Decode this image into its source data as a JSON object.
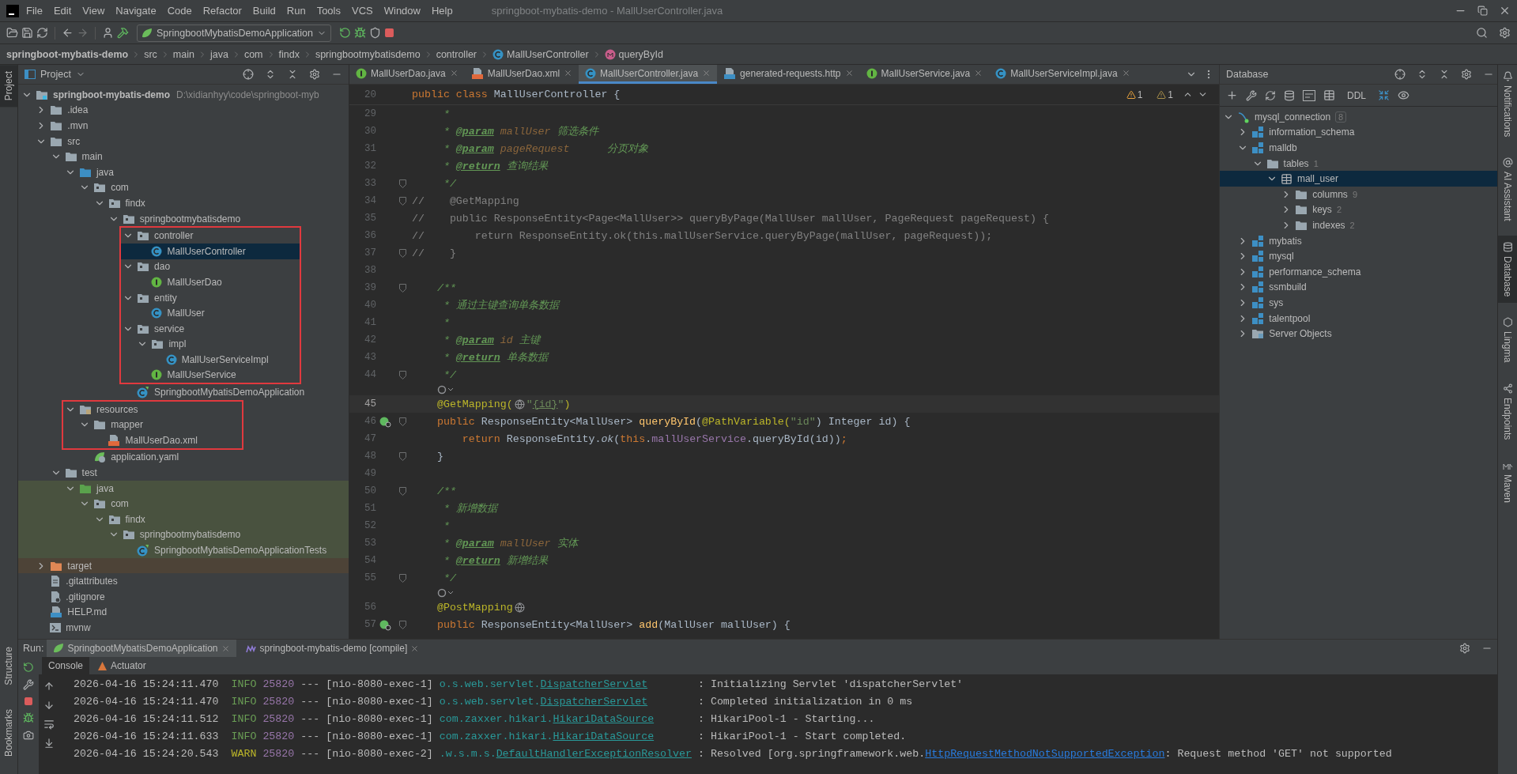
{
  "window": {
    "title": "springboot-mybatis-demo - MallUserController.java"
  },
  "menu": [
    "File",
    "Edit",
    "View",
    "Navigate",
    "Code",
    "Refactor",
    "Build",
    "Run",
    "Tools",
    "VCS",
    "Window",
    "Help"
  ],
  "run_configuration": {
    "label": "SpringbootMybatisDemoApplication"
  },
  "breadcrumbs": [
    {
      "label": "springboot-mybatis-demo",
      "kind": "project"
    },
    {
      "label": "src",
      "kind": "folder"
    },
    {
      "label": "main",
      "kind": "folder"
    },
    {
      "label": "java",
      "kind": "folder"
    },
    {
      "label": "com",
      "kind": "folder"
    },
    {
      "label": "findx",
      "kind": "folder"
    },
    {
      "label": "springbootmybatisdemo",
      "kind": "folder"
    },
    {
      "label": "controller",
      "kind": "folder"
    },
    {
      "label": "MallUserController",
      "kind": "class"
    },
    {
      "label": "queryById",
      "kind": "method"
    }
  ],
  "left_strip": {
    "top": [
      {
        "label": "Project",
        "selected": true
      }
    ],
    "bottom": [
      {
        "label": "Structure",
        "selected": false
      },
      {
        "label": "Bookmarks",
        "selected": false
      }
    ]
  },
  "project": {
    "title": "Project",
    "tree": [
      {
        "label": "springboot-mybatis-demo",
        "path": "D:\\xidianhyy\\code\\springboot-myb",
        "kind": "module",
        "expanded": true,
        "selected": false,
        "highlighted": false,
        "children": [
          {
            "label": ".idea",
            "kind": "folder",
            "expanded": false,
            "selected": false,
            "highlighted": false
          },
          {
            "label": ".mvn",
            "kind": "folder",
            "expanded": false,
            "selected": false,
            "highlighted": false
          },
          {
            "label": "src",
            "kind": "folder",
            "expanded": true,
            "selected": false,
            "highlighted": false,
            "children": [
              {
                "label": "main",
                "kind": "folder",
                "expanded": true,
                "selected": false,
                "highlighted": false,
                "children": [
                  {
                    "label": "java",
                    "kind": "source",
                    "expanded": true,
                    "selected": false,
                    "highlighted": false,
                    "children": [
                      {
                        "label": "com",
                        "kind": "package",
                        "expanded": true,
                        "selected": false,
                        "highlighted": false,
                        "children": [
                          {
                            "label": "findx",
                            "kind": "package",
                            "expanded": true,
                            "selected": false,
                            "highlighted": false,
                            "children": [
                              {
                                "label": "springbootmybatisdemo",
                                "kind": "package",
                                "expanded": true,
                                "selected": false,
                                "highlighted": false,
                                "children": [
                                  {
                                    "label": "controller",
                                    "kind": "package",
                                    "expanded": true,
                                    "selected": false,
                                    "highlighted": true,
                                    "children": [
                                      {
                                        "label": "MallUserController",
                                        "kind": "class",
                                        "selected": true,
                                        "highlighted": true
                                      }
                                    ]
                                  },
                                  {
                                    "label": "dao",
                                    "kind": "package",
                                    "expanded": true,
                                    "selected": false,
                                    "highlighted": true,
                                    "children": [
                                      {
                                        "label": "MallUserDao",
                                        "kind": "interface",
                                        "selected": false,
                                        "highlighted": true
                                      }
                                    ]
                                  },
                                  {
                                    "label": "entity",
                                    "kind": "package",
                                    "expanded": true,
                                    "selected": false,
                                    "highlighted": true,
                                    "children": [
                                      {
                                        "label": "MallUser",
                                        "kind": "class",
                                        "selected": false,
                                        "highlighted": true
                                      }
                                    ]
                                  },
                                  {
                                    "label": "service",
                                    "kind": "package",
                                    "expanded": true,
                                    "selected": false,
                                    "highlighted": true,
                                    "children": [
                                      {
                                        "label": "impl",
                                        "kind": "package",
                                        "expanded": true,
                                        "selected": false,
                                        "highlighted": true,
                                        "children": [
                                          {
                                            "label": "MallUserServiceImpl",
                                            "kind": "class",
                                            "selected": false,
                                            "highlighted": true
                                          }
                                        ]
                                      },
                                      {
                                        "label": "MallUserService",
                                        "kind": "interface",
                                        "selected": false,
                                        "highlighted": true
                                      }
                                    ]
                                  },
                                  {
                                    "label": "SpringbootMybatisDemoApplication",
                                    "kind": "app-class",
                                    "selected": false,
                                    "highlighted": false
                                  }
                                ]
                              }
                            ]
                          }
                        ]
                      }
                    ]
                  },
                  {
                    "label": "resources",
                    "kind": "resources",
                    "expanded": true,
                    "selected": false,
                    "highlighted": true,
                    "children": [
                      {
                        "label": "mapper",
                        "kind": "folder",
                        "expanded": true,
                        "selected": false,
                        "highlighted": true,
                        "children": [
                          {
                            "label": "MallUserDao.xml",
                            "kind": "xml",
                            "selected": false,
                            "highlighted": true
                          }
                        ]
                      },
                      {
                        "label": "application.yaml",
                        "kind": "yaml",
                        "selected": false,
                        "highlighted": false
                      }
                    ]
                  }
                ]
              },
              {
                "label": "test",
                "kind": "folder",
                "expanded": true,
                "selected": false,
                "highlighted": false,
                "children": [
                  {
                    "label": "java",
                    "kind": "test-source",
                    "expanded": true,
                    "selected": false,
                    "highlighted": false,
                    "children": [
                      {
                        "label": "com",
                        "kind": "package",
                        "expanded": true,
                        "selected": false,
                        "highlighted": false,
                        "children": [
                          {
                            "label": "findx",
                            "kind": "package",
                            "expanded": true,
                            "selected": false,
                            "highlighted": false,
                            "children": [
                              {
                                "label": "springbootmybatisdemo",
                                "kind": "package",
                                "expanded": true,
                                "selected": false,
                                "highlighted": false,
                                "children": [
                                  {
                                    "label": "SpringbootMybatisDemoApplicationTests",
                                    "kind": "app-class",
                                    "selected": false,
                                    "highlighted": false
                                  }
                                ]
                              }
                            ]
                          }
                        ]
                      }
                    ]
                  }
                ]
              }
            ]
          },
          {
            "label": "target",
            "kind": "excluded",
            "expanded": false,
            "selected": false,
            "highlighted": false
          },
          {
            "label": ".gitattributes",
            "kind": "text",
            "selected": false,
            "highlighted": false
          },
          {
            "label": ".gitignore",
            "kind": "git",
            "selected": false,
            "highlighted": false
          },
          {
            "label": "HELP.md",
            "kind": "md",
            "selected": false,
            "highlighted": false
          },
          {
            "label": "mvnw",
            "kind": "shell",
            "selected": false,
            "highlighted": false
          }
        ]
      }
    ]
  },
  "editor": {
    "tabs": [
      {
        "label": "MallUserDao.java",
        "kind": "interface",
        "selected": false
      },
      {
        "label": "MallUserDao.xml",
        "kind": "xml",
        "selected": false
      },
      {
        "label": "MallUserController.java",
        "kind": "class",
        "selected": true
      },
      {
        "label": "generated-requests.http",
        "kind": "http",
        "selected": false
      },
      {
        "label": "MallUserService.java",
        "kind": "interface",
        "selected": false
      },
      {
        "label": "MallUserServiceImpl.java",
        "kind": "class",
        "selected": false
      }
    ],
    "sticky_line": {
      "number": "20",
      "tokens": [
        {
          "kind": "keyword",
          "text": "public class"
        },
        {
          "kind": "plain",
          "text": " MallUserController {"
        }
      ]
    },
    "inspections": [
      {
        "kind": "warning",
        "count": "1"
      },
      {
        "kind": "weak",
        "count": "1"
      }
    ],
    "lines": [
      {
        "kind": "code",
        "number": "29",
        "tokens": [
          {
            "kind": "doc",
            "text": "     *"
          }
        ]
      },
      {
        "kind": "code",
        "number": "30",
        "tokens": [
          {
            "kind": "doc",
            "text": "     * "
          },
          {
            "kind": "doctag",
            "text": "@param"
          },
          {
            "kind": "docparam",
            "text": " mallUser"
          },
          {
            "kind": "doc",
            "text": " 筛选条件"
          }
        ]
      },
      {
        "kind": "code",
        "number": "31",
        "tokens": [
          {
            "kind": "doc",
            "text": "     * "
          },
          {
            "kind": "doctag",
            "text": "@param"
          },
          {
            "kind": "docparam",
            "text": " pageRequest"
          },
          {
            "kind": "doc",
            "text": "      分页对象"
          }
        ]
      },
      {
        "kind": "code",
        "number": "32",
        "tokens": [
          {
            "kind": "doc",
            "text": "     * "
          },
          {
            "kind": "doctag",
            "text": "@return"
          },
          {
            "kind": "doc",
            "text": " 查询结果"
          }
        ]
      },
      {
        "kind": "code",
        "number": "33",
        "fold": true,
        "tokens": [
          {
            "kind": "doc",
            "text": "     */"
          }
        ]
      },
      {
        "kind": "code",
        "number": "34",
        "fold": true,
        "tokens": [
          {
            "kind": "comment",
            "text": "//    @GetMapping"
          }
        ]
      },
      {
        "kind": "code",
        "number": "35",
        "tokens": [
          {
            "kind": "comment",
            "text": "//    public ResponseEntity<Page<MallUser>> queryByPage(MallUser mallUser, PageRequest pageRequest) {"
          }
        ]
      },
      {
        "kind": "code",
        "number": "36",
        "tokens": [
          {
            "kind": "comment",
            "text": "//        return ResponseEntity.ok(this.mallUserService.queryByPage(mallUser, pageRequest));"
          }
        ]
      },
      {
        "kind": "code",
        "number": "37",
        "fold": true,
        "tokens": [
          {
            "kind": "comment",
            "text": "//    }"
          }
        ]
      },
      {
        "kind": "code",
        "number": "38"
      },
      {
        "kind": "code",
        "number": "39",
        "fold": true,
        "tokens": [
          {
            "kind": "doc",
            "text": "    /**"
          }
        ]
      },
      {
        "kind": "code",
        "number": "40",
        "tokens": [
          {
            "kind": "doc",
            "text": "     * 通过主键查询单条数据"
          }
        ]
      },
      {
        "kind": "code",
        "number": "41",
        "tokens": [
          {
            "kind": "doc",
            "text": "     *"
          }
        ]
      },
      {
        "kind": "code",
        "number": "42",
        "tokens": [
          {
            "kind": "doc",
            "text": "     * "
          },
          {
            "kind": "doctag",
            "text": "@param"
          },
          {
            "kind": "docparam",
            "text": " id"
          },
          {
            "kind": "doc",
            "text": " 主键"
          }
        ]
      },
      {
        "kind": "code",
        "number": "43",
        "tokens": [
          {
            "kind": "doc",
            "text": "     * "
          },
          {
            "kind": "doctag",
            "text": "@return"
          },
          {
            "kind": "doc",
            "text": " 单条数据"
          }
        ]
      },
      {
        "kind": "code",
        "number": "44",
        "fold": true,
        "tokens": [
          {
            "kind": "doc",
            "text": "     */"
          }
        ]
      },
      {
        "kind": "inlay"
      },
      {
        "kind": "code",
        "number": "45",
        "current": true,
        "tokens": [
          {
            "kind": "annotation",
            "text": "    @GetMapping("
          },
          {
            "kind": "icon"
          },
          {
            "kind": "string",
            "text": "\""
          },
          {
            "kind": "string-ref",
            "text": "{id}"
          },
          {
            "kind": "string",
            "text": "\""
          },
          {
            "kind": "annotation",
            "text": ")"
          }
        ]
      },
      {
        "kind": "code",
        "number": "46",
        "run": true,
        "fold": true,
        "tokens": [
          {
            "kind": "keyword",
            "text": "    public"
          },
          {
            "kind": "plain",
            "text": " ResponseEntity<MallUser> "
          },
          {
            "kind": "method",
            "text": "queryById"
          },
          {
            "kind": "plain",
            "text": "("
          },
          {
            "kind": "annotation",
            "text": "@PathVariable("
          },
          {
            "kind": "string",
            "text": "\"id\""
          },
          {
            "kind": "plain",
            "text": ") Integer id) {"
          }
        ]
      },
      {
        "kind": "code",
        "number": "47",
        "tokens": [
          {
            "kind": "keyword",
            "text": "        return"
          },
          {
            "kind": "plain",
            "text": " ResponseEntity."
          },
          {
            "kind": "static",
            "text": "ok"
          },
          {
            "kind": "plain",
            "text": "("
          },
          {
            "kind": "keyword",
            "text": "this"
          },
          {
            "kind": "plain",
            "text": "."
          },
          {
            "kind": "field",
            "text": "mallUserService"
          },
          {
            "kind": "plain",
            "text": ".queryById(id))"
          },
          {
            "kind": "keyword",
            "text": ";"
          }
        ]
      },
      {
        "kind": "code",
        "number": "48",
        "fold": true,
        "tokens": [
          {
            "kind": "plain",
            "text": "    }"
          }
        ]
      },
      {
        "kind": "code",
        "number": "49"
      },
      {
        "kind": "code",
        "number": "50",
        "fold": true,
        "tokens": [
          {
            "kind": "doc",
            "text": "    /**"
          }
        ]
      },
      {
        "kind": "code",
        "number": "51",
        "tokens": [
          {
            "kind": "doc",
            "text": "     * 新增数据"
          }
        ]
      },
      {
        "kind": "code",
        "number": "52",
        "tokens": [
          {
            "kind": "doc",
            "text": "     *"
          }
        ]
      },
      {
        "kind": "code",
        "number": "53",
        "tokens": [
          {
            "kind": "doc",
            "text": "     * "
          },
          {
            "kind": "doctag",
            "text": "@param"
          },
          {
            "kind": "docparam",
            "text": " mallUser"
          },
          {
            "kind": "doc",
            "text": " 实体"
          }
        ]
      },
      {
        "kind": "code",
        "number": "54",
        "tokens": [
          {
            "kind": "doc",
            "text": "     * "
          },
          {
            "kind": "doctag",
            "text": "@return"
          },
          {
            "kind": "doc",
            "text": " 新增结果"
          }
        ]
      },
      {
        "kind": "code",
        "number": "55",
        "fold": true,
        "tokens": [
          {
            "kind": "doc",
            "text": "     */"
          }
        ]
      },
      {
        "kind": "inlay"
      },
      {
        "kind": "code",
        "number": "56",
        "tokens": [
          {
            "kind": "annotation",
            "text": "    @PostMapping"
          },
          {
            "kind": "icon"
          }
        ]
      },
      {
        "kind": "code",
        "number": "57",
        "run": true,
        "fold": true,
        "tokens": [
          {
            "kind": "keyword",
            "text": "    public"
          },
          {
            "kind": "plain",
            "text": " ResponseEntity<MallUser> "
          },
          {
            "kind": "method",
            "text": "add"
          },
          {
            "kind": "plain",
            "text": "(MallUser mallUser) {"
          }
        ]
      }
    ]
  },
  "database": {
    "title": "Database",
    "ddl": "DDL",
    "tree": [
      {
        "label": "mysql_connection",
        "kind": "connection",
        "count": "8",
        "expanded": true,
        "selected": false,
        "children": [
          {
            "label": "information_schema",
            "kind": "schema",
            "expanded": false,
            "selected": false
          },
          {
            "label": "malldb",
            "kind": "schema",
            "expanded": true,
            "selected": false,
            "children": [
              {
                "label": "tables",
                "kind": "folder",
                "count": "1",
                "expanded": true,
                "selected": false,
                "children": [
                  {
                    "label": "mall_user",
                    "kind": "table",
                    "expanded": true,
                    "selected": true,
                    "children": [
                      {
                        "label": "columns",
                        "kind": "folder",
                        "count": "9",
                        "expanded": false,
                        "selected": false
                      },
                      {
                        "label": "keys",
                        "kind": "folder",
                        "count": "2",
                        "expanded": false,
                        "selected": false
                      },
                      {
                        "label": "indexes",
                        "kind": "folder",
                        "count": "2",
                        "expanded": false,
                        "selected": false
                      }
                    ]
                  }
                ]
              }
            ]
          },
          {
            "label": "mybatis",
            "kind": "schema",
            "expanded": false,
            "selected": false
          },
          {
            "label": "mysql",
            "kind": "schema",
            "expanded": false,
            "selected": false
          },
          {
            "label": "performance_schema",
            "kind": "schema",
            "expanded": false,
            "selected": false
          },
          {
            "label": "ssmbuild",
            "kind": "schema",
            "expanded": false,
            "selected": false
          },
          {
            "label": "sys",
            "kind": "schema",
            "expanded": false,
            "selected": false
          },
          {
            "label": "talentpool",
            "kind": "schema",
            "expanded": false,
            "selected": false
          },
          {
            "label": "Server Objects",
            "kind": "server",
            "expanded": false,
            "selected": false
          }
        ]
      }
    ]
  },
  "right_strip": [
    {
      "label": "Notifications",
      "kind": "bell",
      "selected": false
    },
    {
      "label": "AI Assistant",
      "kind": "at",
      "selected": false
    },
    {
      "label": "Database",
      "kind": "database",
      "selected": true
    },
    {
      "label": "Lingma",
      "kind": "lingma",
      "selected": false
    },
    {
      "label": "Endpoints",
      "kind": "endpoints",
      "selected": false
    },
    {
      "label": "Maven",
      "kind": "maven",
      "selected": false
    }
  ],
  "run": {
    "title": "Run:",
    "tabs": [
      {
        "label": "SpringbootMybatisDemoApplication",
        "kind": "spring",
        "selected": true
      },
      {
        "label": "springboot-mybatis-demo [compile]",
        "kind": "maven",
        "selected": false
      }
    ],
    "subtabs": [
      {
        "label": "Console",
        "kind": "console",
        "selected": true
      },
      {
        "label": "Actuator",
        "kind": "actuator",
        "selected": false
      }
    ],
    "log": [
      {
        "time": "2026-04-16 15:24:11.470",
        "level": "INFO",
        "kind": "info",
        "pid": "25820",
        "separator": "---",
        "thread": "[nio-8080-exec-1]",
        "logger_package": "o.s.web.servlet.",
        "logger_class": "DispatcherServlet",
        "message": [
          {
            "text": ": Initializing Servlet 'dispatcherServlet'",
            "link": false
          }
        ]
      },
      {
        "time": "2026-04-16 15:24:11.470",
        "level": "INFO",
        "kind": "info",
        "pid": "25820",
        "separator": "---",
        "thread": "[nio-8080-exec-1]",
        "logger_package": "o.s.web.servlet.",
        "logger_class": "DispatcherServlet",
        "message": [
          {
            "text": ": Completed initialization in 0 ms",
            "link": false
          }
        ]
      },
      {
        "time": "2026-04-16 15:24:11.512",
        "level": "INFO",
        "kind": "info",
        "pid": "25820",
        "separator": "---",
        "thread": "[nio-8080-exec-1]",
        "logger_package": "com.zaxxer.hikari.",
        "logger_class": "HikariDataSource",
        "message": [
          {
            "text": ": HikariPool-1 - Starting...",
            "link": false
          }
        ]
      },
      {
        "time": "2026-04-16 15:24:11.633",
        "level": "INFO",
        "kind": "info",
        "pid": "25820",
        "separator": "---",
        "thread": "[nio-8080-exec-1]",
        "logger_package": "com.zaxxer.hikari.",
        "logger_class": "HikariDataSource",
        "message": [
          {
            "text": ": HikariPool-1 - Start completed.",
            "link": false
          }
        ]
      },
      {
        "time": "2026-04-16 15:24:20.543",
        "level": "WARN",
        "kind": "warn",
        "pid": "25820",
        "separator": "---",
        "thread": "[nio-8080-exec-2]",
        "logger_package": ".w.s.m.s.",
        "logger_class": "DefaultHandlerExceptionResolver",
        "message": [
          {
            "text": ": Resolved [org.springframework.web.",
            "link": false
          },
          {
            "text": "HttpRequestMethodNotSupportedException",
            "link": true
          },
          {
            "text": ": Request method 'GET' not supported",
            "link": false
          }
        ]
      }
    ]
  }
}
